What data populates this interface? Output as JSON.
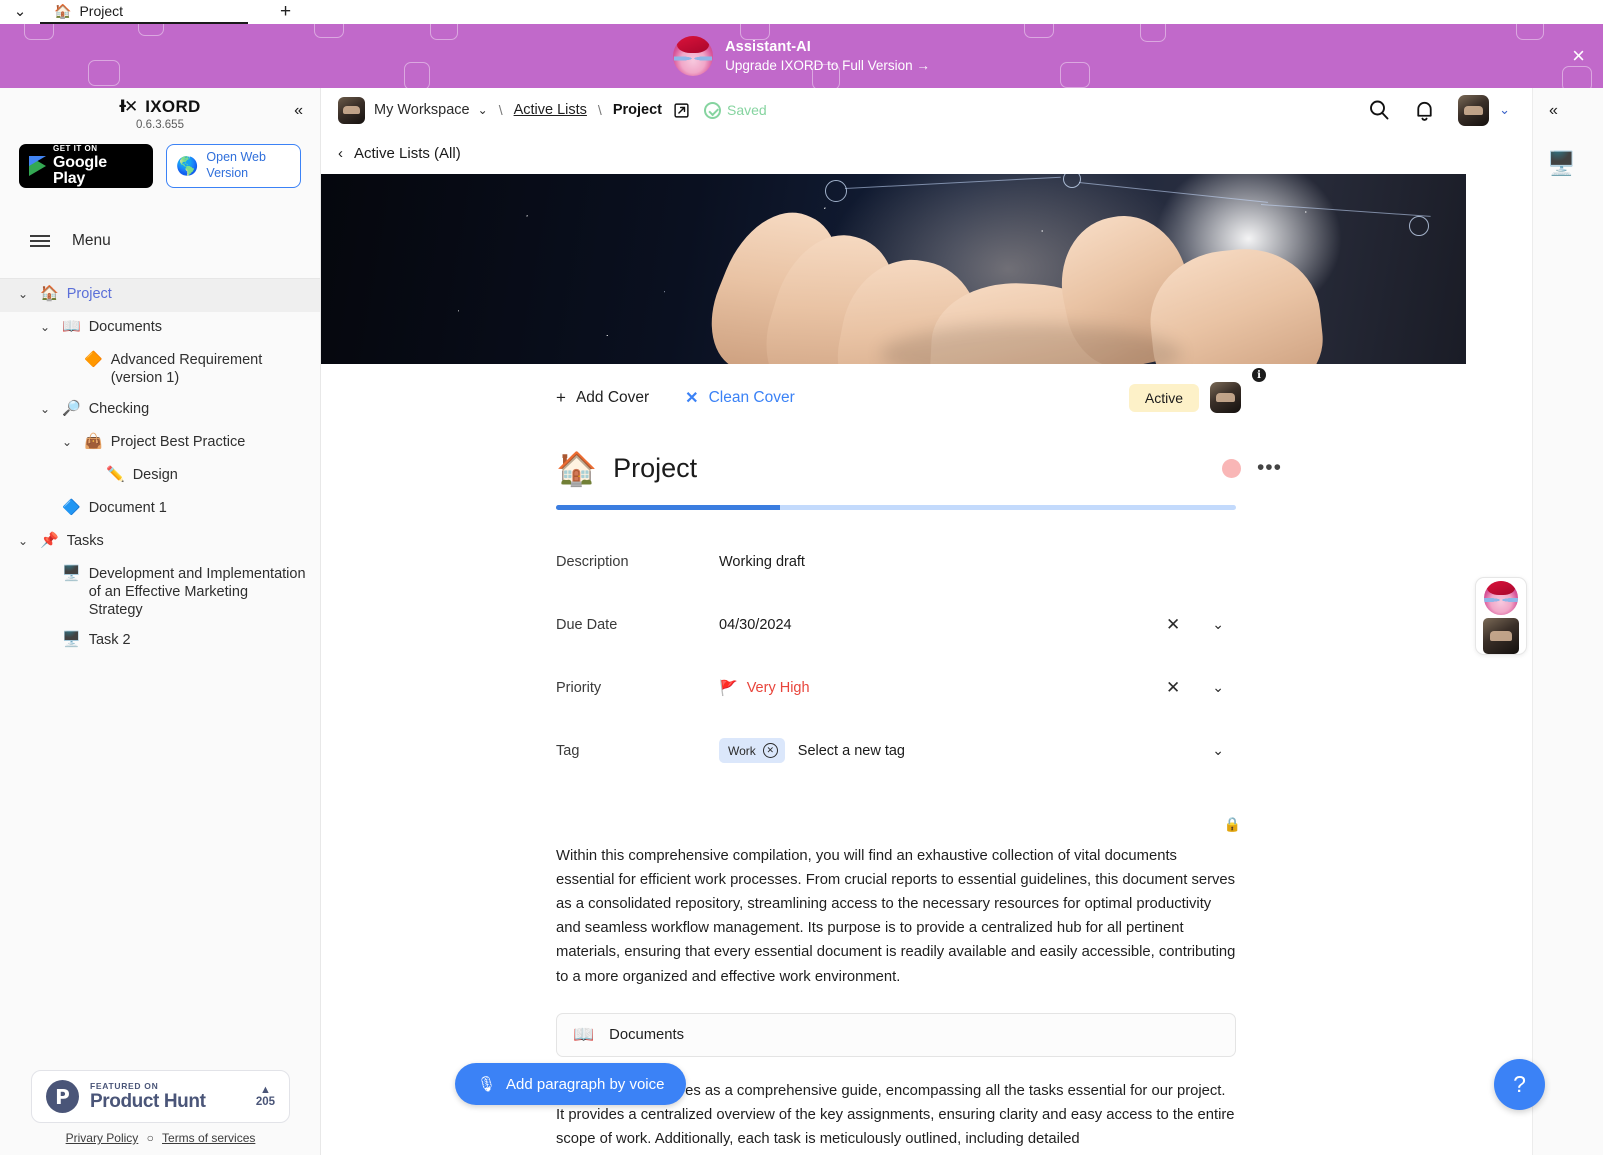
{
  "browser": {
    "chevron_icon": "⌄",
    "tab": {
      "emoji": "🏠",
      "title": "Project"
    },
    "new_tab_label": "+"
  },
  "promo": {
    "title": "Assistant-AI",
    "subtitle": "Upgrade IXORD to Full Version  →",
    "close_label": "×",
    "bg_color": "#c169ca"
  },
  "sidebar": {
    "brand_mark": "Ɨ✕",
    "brand_name": "IXORD",
    "version": "0.6.3.655",
    "collapse_icon": "«",
    "google_play": {
      "small": "GET IT ON",
      "big": "Google Play"
    },
    "open_web": {
      "label": "Open Web Version",
      "globe": "🌎"
    },
    "menu_label": "Menu",
    "tree": [
      {
        "indent": 0,
        "twisty": "⌄",
        "emoji": "🏠",
        "label": "Project",
        "active": true,
        "accent": true
      },
      {
        "indent": 1,
        "twisty": "⌄",
        "emoji": "📖",
        "label": "Documents",
        "active": false,
        "accent": false
      },
      {
        "indent": 2,
        "twisty": "",
        "emoji": "🔶",
        "label": "Advanced Requirement (version 1)",
        "active": false,
        "accent": false
      },
      {
        "indent": 1,
        "twisty": "⌄",
        "emoji": "🔎",
        "label": "Checking",
        "active": false,
        "accent": false
      },
      {
        "indent": 2,
        "twisty": "⌄",
        "emoji": "👜",
        "label": "Project Best Practice",
        "active": false,
        "accent": false
      },
      {
        "indent": 3,
        "twisty": "",
        "emoji": "✏️",
        "label": "Design",
        "active": false,
        "accent": false
      },
      {
        "indent": 1,
        "twisty": "",
        "emoji": "🔷",
        "label": "Document 1",
        "active": false,
        "accent": false
      },
      {
        "indent": 0,
        "twisty": "⌄",
        "emoji": "📌",
        "label": "Tasks",
        "active": false,
        "accent": false
      },
      {
        "indent": 1,
        "twisty": "",
        "emoji": "🖥️",
        "label": "Development and Implementation of an Effective Marketing Strategy",
        "active": false,
        "accent": false
      },
      {
        "indent": 1,
        "twisty": "",
        "emoji": "🖥️",
        "label": "Task 2",
        "active": false,
        "accent": false
      }
    ],
    "product_hunt": {
      "logo_letter": "P",
      "small": "FEATURED ON",
      "big": "Product Hunt",
      "triangle": "▲",
      "count": "205"
    },
    "footer": {
      "privacy": "Privary Policy",
      "separator": "○",
      "terms": "Terms of services"
    }
  },
  "topbar": {
    "workspace": "My Workspace",
    "workspace_chevron": "⌄",
    "sep1": "\\",
    "active_lists": "Active Lists",
    "sep2": "\\",
    "current": "Project",
    "external_icon": "↗",
    "saved_label": "Saved",
    "search_icon": "search-icon",
    "bell_icon": "bell-icon",
    "user_chevron": "⌄"
  },
  "backbar": {
    "chevron": "‹",
    "label": "Active Lists (All)"
  },
  "cover_actions": {
    "add_cover": "Add Cover",
    "add_plus": "+",
    "clean_cover": "Clean Cover",
    "clean_x": "✕"
  },
  "record": {
    "status": "Active",
    "info_icon": "i",
    "title_emoji": "🏠",
    "title": "Project",
    "more_icon": "•••",
    "progress_percent": 33,
    "properties": [
      {
        "label": "Description",
        "value": "Working draft",
        "type": "text",
        "has_actions": false
      },
      {
        "label": "Due Date",
        "value": "04/30/2024",
        "type": "text",
        "has_actions": true
      },
      {
        "label": "Priority",
        "value": "Very High",
        "type": "priority",
        "flag": "🚩",
        "has_actions": true
      },
      {
        "label": "Tag",
        "value": "Work",
        "placeholder": "Select a new tag",
        "type": "tag",
        "has_actions": true
      }
    ],
    "clear_icon": "✕",
    "expand_icon": "⌄",
    "lock_icon": "🔒"
  },
  "body": {
    "paragraph1": "Within this comprehensive compilation, you will find an exhaustive collection of vital documents essential for efficient work processes. From crucial reports to essential guidelines, this document serves as a consolidated repository, streamlining access to the necessary resources for optimal productivity and seamless workflow management. Its purpose is to provide a centralized hub for all pertinent materials, ensuring that every essential document is readily available and easily accessible, contributing to a more organized and effective work environment.",
    "doc_card": {
      "emoji": "📖",
      "label": "Documents"
    },
    "paragraph2": "This document serves as a comprehensive guide, encompassing all the tasks essential for our project. It provides a centralized overview of the key assignments, ensuring clarity and easy access to the entire scope of work. Additionally, each task is meticulously outlined, including detailed"
  },
  "voice_button": {
    "mic_icon": "🎙",
    "label": "Add paragraph by voice"
  },
  "rail": {
    "collapse_icon": "«",
    "monitor_icon": "🖥️"
  },
  "help_fab": {
    "label": "?"
  }
}
